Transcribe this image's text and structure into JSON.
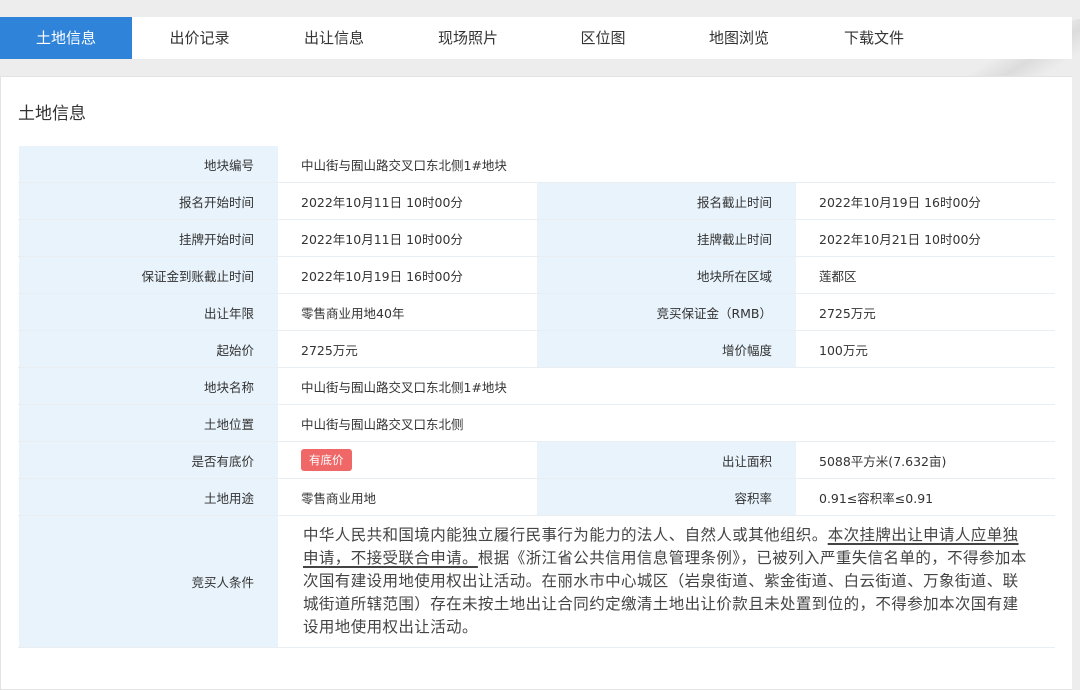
{
  "tabs": [
    {
      "label": "土地信息",
      "active": true
    },
    {
      "label": "出价记录",
      "active": false
    },
    {
      "label": "出让信息",
      "active": false
    },
    {
      "label": "现场照片",
      "active": false
    },
    {
      "label": "区位图",
      "active": false
    },
    {
      "label": "地图浏览",
      "active": false
    },
    {
      "label": "下载文件",
      "active": false
    }
  ],
  "panel": {
    "title": "土地信息"
  },
  "fields": {
    "parcel_no_label": "地块编号",
    "parcel_no": "中山街与囿山路交叉口东北侧1#地块",
    "reg_start_label": "报名开始时间",
    "reg_start": "2022年10月11日 10时00分",
    "reg_end_label": "报名截止时间",
    "reg_end": "2022年10月19日 16时00分",
    "list_start_label": "挂牌开始时间",
    "list_start": "2022年10月11日 10时00分",
    "list_end_label": "挂牌截止时间",
    "list_end": "2022年10月21日 10时00分",
    "deposit_deadline_label": "保证金到账截止时间",
    "deposit_deadline": "2022年10月19日 16时00分",
    "district_label": "地块所在区域",
    "district": "莲都区",
    "term_label": "出让年限",
    "term": "零售商业用地40年",
    "deposit_label": "竞买保证金（RMB）",
    "deposit": "2725万元",
    "start_price_label": "起始价",
    "start_price": "2725万元",
    "increment_label": "增价幅度",
    "increment": "100万元",
    "name_label": "地块名称",
    "name": "中山街与囿山路交叉口东北侧1#地块",
    "location_label": "土地位置",
    "location": "中山街与囿山路交叉口东北侧",
    "reserve_label": "是否有底价",
    "reserve_badge": "有底价",
    "area_label": "出让面积",
    "area": "5088平方米(7.632亩)",
    "use_label": "土地用途",
    "use": "零售商业用地",
    "far_label": "容积率",
    "far": "0.91≤容积率≤0.91",
    "conditions_label": "竞买人条件",
    "conditions_p1": "中华人民共和国境内能独立履行民事行为能力的法人、自然人或其他组织。",
    "conditions_p2": "本次挂牌出让申请人应单独申请，不接受联合申请。",
    "conditions_p3": "根据《浙江省公共信用信息管理条例》，已被列入严重失信名单的，不得参加本次国有建设用地使用权出让活动。在丽水市中心城区（岩泉街道、紫金街道、白云街道、万象街道、联城街道所辖范围）存在未按土地出让合同约定缴清土地出让价款且未处置到位的，不得参加本次国有建设用地使用权出让活动。"
  },
  "colors": {
    "accent": "#2f84d9",
    "label_bg": "#e8f3fb",
    "badge": "#f06767"
  }
}
